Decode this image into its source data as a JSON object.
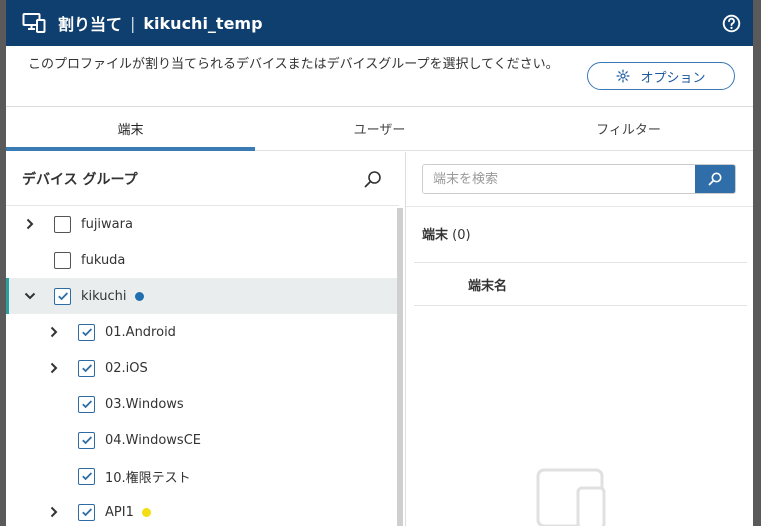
{
  "dialog": {
    "title_prefix": "割り当て",
    "title_separator": "|",
    "title_name": "kikuchi_temp",
    "description": "このプロファイルが割り当てられるデバイスまたはデバイスグループを選択してください。",
    "option_label": "オプション"
  },
  "tabs": [
    {
      "label": "端末",
      "active": true
    },
    {
      "label": "ユーザー",
      "active": false
    },
    {
      "label": "フィルター",
      "active": false
    }
  ],
  "left": {
    "header": "デバイス グループ",
    "rows": [
      {
        "label": "fujiwara",
        "checked": false,
        "expandable": true,
        "level": 0,
        "selected": false,
        "dot": ""
      },
      {
        "label": "fukuda",
        "checked": false,
        "expandable": false,
        "level": 0,
        "selected": false,
        "dot": ""
      },
      {
        "label": "kikuchi",
        "checked": true,
        "expandable": true,
        "expanded": true,
        "level": 0,
        "selected": true,
        "dot": "#1f6fb0"
      },
      {
        "label": "01.Android",
        "checked": true,
        "expandable": true,
        "level": 1,
        "selected": false,
        "dot": ""
      },
      {
        "label": "02.iOS",
        "checked": true,
        "expandable": true,
        "level": 1,
        "selected": false,
        "dot": ""
      },
      {
        "label": "03.Windows",
        "checked": true,
        "expandable": false,
        "level": 1,
        "selected": false,
        "dot": ""
      },
      {
        "label": "04.WindowsCE",
        "checked": true,
        "expandable": false,
        "level": 1,
        "selected": false,
        "dot": ""
      },
      {
        "label": "10.権限テスト",
        "checked": true,
        "expandable": false,
        "level": 1,
        "selected": false,
        "dot": ""
      },
      {
        "label": "API1",
        "checked": true,
        "expandable": true,
        "level": 1,
        "selected": false,
        "dot": "#f2de12"
      }
    ]
  },
  "right": {
    "search_placeholder": "端末を検索",
    "count_label": "端末",
    "count_value": "(0)",
    "column_header": "端末名"
  },
  "colors": {
    "titlebar": "#0f3f6e",
    "accent": "#3a7ab5",
    "selected_marker": "#2a9fa0"
  }
}
